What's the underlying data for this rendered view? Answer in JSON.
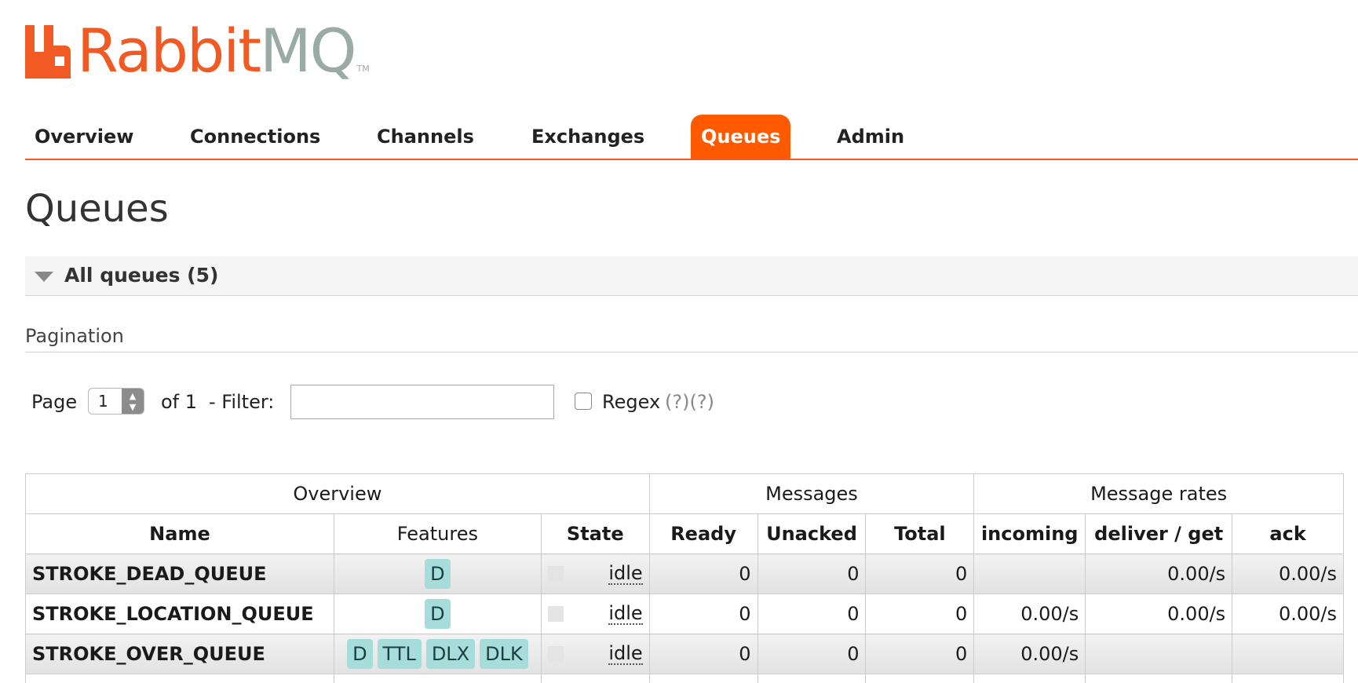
{
  "logo": {
    "text_rabbit": "Rabbit",
    "text_mq": "MQ",
    "tm": "TM"
  },
  "nav": {
    "items": [
      {
        "label": "Overview",
        "active": false
      },
      {
        "label": "Connections",
        "active": false
      },
      {
        "label": "Channels",
        "active": false
      },
      {
        "label": "Exchanges",
        "active": false
      },
      {
        "label": "Queues",
        "active": true
      },
      {
        "label": "Admin",
        "active": false
      }
    ]
  },
  "page": {
    "title": "Queues"
  },
  "section": {
    "title": "All queues (5)"
  },
  "pagination": {
    "label": "Pagination",
    "page_label": "Page",
    "page_value": "1",
    "of_label": "of 1",
    "filter_label": "- Filter:",
    "filter_value": "",
    "regex_label": "Regex",
    "regex_help": "(?)(?)",
    "regex_checked": false
  },
  "table": {
    "groups": [
      "Overview",
      "Messages",
      "Message rates"
    ],
    "columns": [
      "Name",
      "Features",
      "State",
      "Ready",
      "Unacked",
      "Total",
      "incoming",
      "deliver / get",
      "ack"
    ],
    "rows": [
      {
        "name": "STROKE_DEAD_QUEUE",
        "features": [
          "D"
        ],
        "state": "idle",
        "ready": "0",
        "unacked": "0",
        "total": "0",
        "incoming": "",
        "deliver_get": "0.00/s",
        "ack": "0.00/s"
      },
      {
        "name": "STROKE_LOCATION_QUEUE",
        "features": [
          "D"
        ],
        "state": "idle",
        "ready": "0",
        "unacked": "0",
        "total": "0",
        "incoming": "0.00/s",
        "deliver_get": "0.00/s",
        "ack": "0.00/s"
      },
      {
        "name": "STROKE_OVER_QUEUE",
        "features": [
          "D",
          "TTL",
          "DLX",
          "DLK"
        ],
        "state": "idle",
        "ready": "0",
        "unacked": "0",
        "total": "0",
        "incoming": "0.00/s",
        "deliver_get": "",
        "ack": ""
      }
    ]
  },
  "colors": {
    "brand_orange": "#ff5a00",
    "logo_orange": "#f15a22",
    "logo_gray": "#9aaba5",
    "badge": "#a6ddda"
  }
}
